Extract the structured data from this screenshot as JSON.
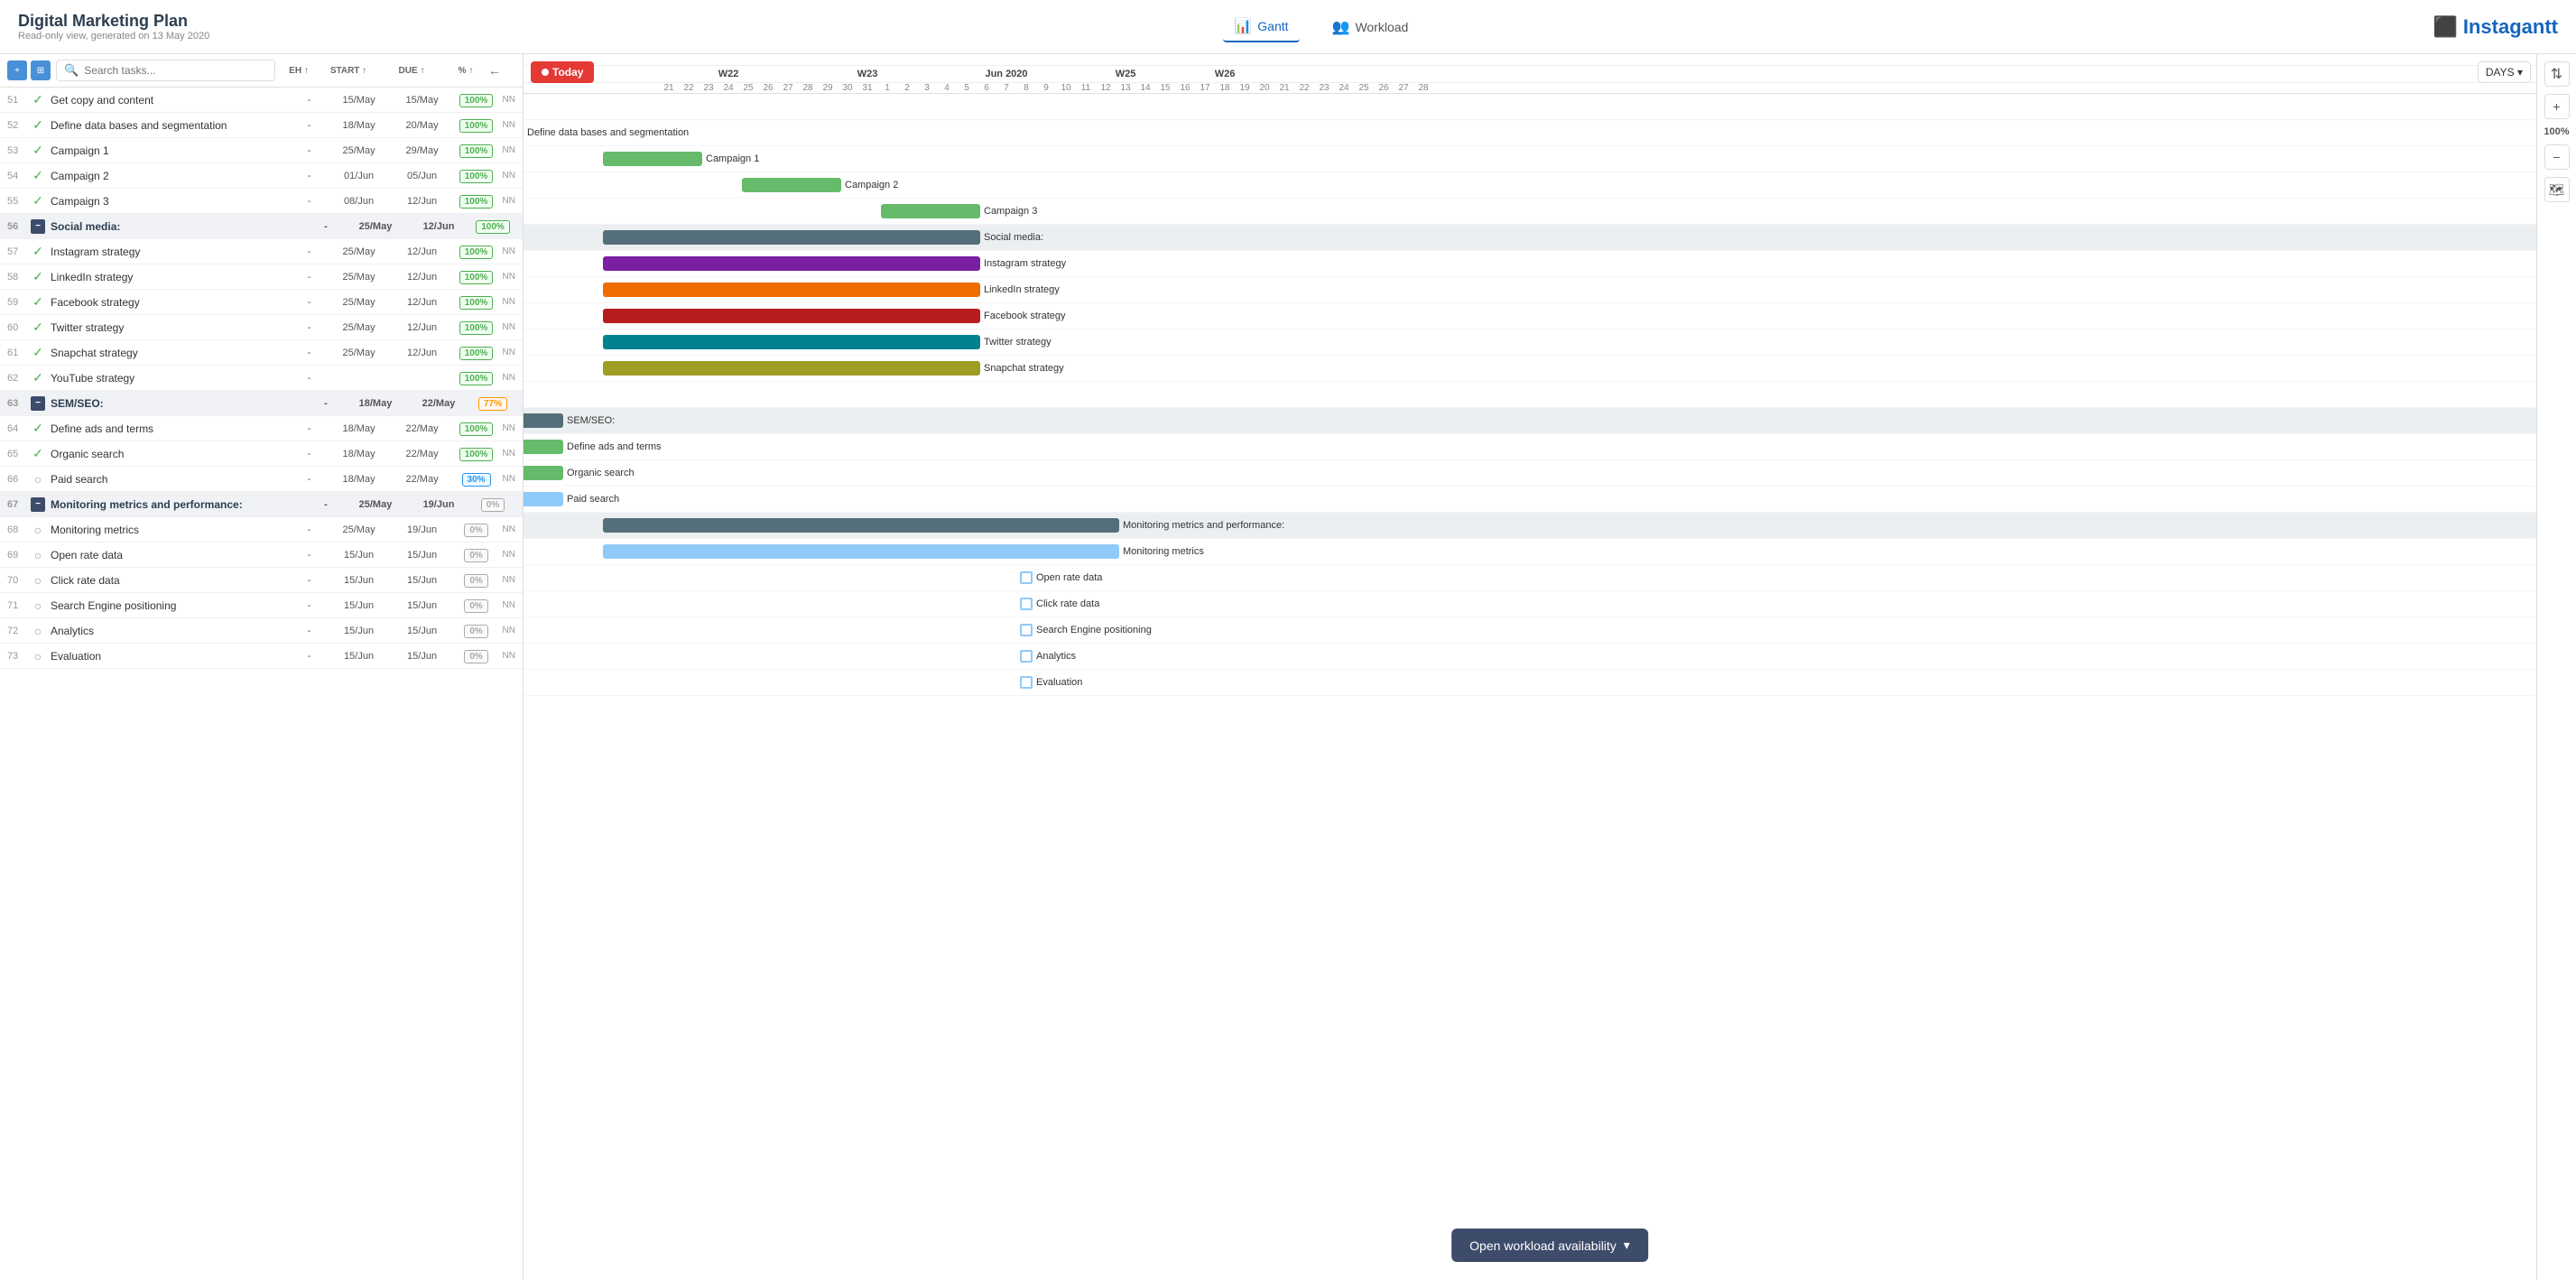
{
  "app": {
    "title": "Digital Marketing Plan",
    "subtitle": "Read-only view, generated on 13 May 2020",
    "logo": "Instagantt"
  },
  "nav": {
    "tabs": [
      {
        "id": "gantt",
        "label": "Gantt",
        "active": true
      },
      {
        "id": "workload",
        "label": "Workload",
        "active": false
      }
    ]
  },
  "toolbar": {
    "search_placeholder": "Search tasks...",
    "col_eh": "EH ↑",
    "col_start": "START ↑",
    "col_due": "DUE ↑",
    "col_pct": "% ↑"
  },
  "gantt": {
    "today_label": "Today",
    "days_label": "DAYS ▾",
    "open_workload_label": "Open workload availability",
    "weeks": [
      {
        "label": "W22",
        "span": 7
      },
      {
        "label": "W23",
        "span": 7
      },
      {
        "label": "Jun 2020",
        "span": 7
      },
      {
        "label": "W25",
        "span": 4
      },
      {
        "label": "W26",
        "span": 4
      }
    ],
    "days": [
      21,
      22,
      23,
      24,
      25,
      26,
      27,
      28,
      29,
      30,
      31,
      1,
      2,
      3,
      4,
      5,
      6,
      7,
      8,
      9,
      10,
      11,
      12,
      13,
      14,
      15,
      16,
      17,
      18,
      19,
      20,
      21,
      22,
      23,
      24,
      25,
      26,
      27,
      28
    ]
  },
  "tasks": [
    {
      "num": 51,
      "check": "done",
      "name": "Get copy and content",
      "eh": "-",
      "start": "15/May",
      "due": "15/May",
      "pct": "100%",
      "pct_class": "done",
      "assignee": "NN"
    },
    {
      "num": 52,
      "check": "done",
      "name": "Define data bases and segmentation",
      "eh": "-",
      "start": "18/May",
      "due": "20/May",
      "pct": "100%",
      "pct_class": "done",
      "assignee": "NN"
    },
    {
      "num": 53,
      "check": "done",
      "name": "Campaign 1",
      "eh": "-",
      "start": "25/May",
      "due": "29/May",
      "pct": "100%",
      "pct_class": "done",
      "assignee": "NN"
    },
    {
      "num": 54,
      "check": "done",
      "name": "Campaign 2",
      "eh": "-",
      "start": "01/Jun",
      "due": "05/Jun",
      "pct": "100%",
      "pct_class": "done",
      "assignee": "NN"
    },
    {
      "num": 55,
      "check": "done",
      "name": "Campaign 3",
      "eh": "-",
      "start": "08/Jun",
      "due": "12/Jun",
      "pct": "100%",
      "pct_class": "done",
      "assignee": "NN"
    },
    {
      "num": 56,
      "check": "group",
      "name": "Social media:",
      "eh": "-",
      "start": "25/May",
      "due": "12/Jun",
      "pct": "100%",
      "pct_class": "done",
      "assignee": "",
      "is_group": true
    },
    {
      "num": 57,
      "check": "done",
      "name": "Instagram strategy",
      "eh": "-",
      "start": "25/May",
      "due": "12/Jun",
      "pct": "100%",
      "pct_class": "done",
      "assignee": "NN"
    },
    {
      "num": 58,
      "check": "done",
      "name": "LinkedIn strategy",
      "eh": "-",
      "start": "25/May",
      "due": "12/Jun",
      "pct": "100%",
      "pct_class": "done",
      "assignee": "NN"
    },
    {
      "num": 59,
      "check": "done",
      "name": "Facebook strategy",
      "eh": "-",
      "start": "25/May",
      "due": "12/Jun",
      "pct": "100%",
      "pct_class": "done",
      "assignee": "NN"
    },
    {
      "num": 60,
      "check": "done",
      "name": "Twitter strategy",
      "eh": "-",
      "start": "25/May",
      "due": "12/Jun",
      "pct": "100%",
      "pct_class": "done",
      "assignee": "NN"
    },
    {
      "num": 61,
      "check": "done",
      "name": "Snapchat strategy",
      "eh": "-",
      "start": "25/May",
      "due": "12/Jun",
      "pct": "100%",
      "pct_class": "done",
      "assignee": "NN"
    },
    {
      "num": 62,
      "check": "done",
      "name": "YouTube strategy",
      "eh": "-",
      "start": "",
      "due": "",
      "pct": "100%",
      "pct_class": "done",
      "assignee": "NN"
    },
    {
      "num": 63,
      "check": "group",
      "name": "SEM/SEO:",
      "eh": "-",
      "start": "18/May",
      "due": "22/May",
      "pct": "77%",
      "pct_class": "amber",
      "assignee": "",
      "is_group": true
    },
    {
      "num": 64,
      "check": "done",
      "name": "Define ads and terms",
      "eh": "-",
      "start": "18/May",
      "due": "22/May",
      "pct": "100%",
      "pct_class": "done",
      "assignee": "NN"
    },
    {
      "num": 65,
      "check": "done",
      "name": "Organic search",
      "eh": "-",
      "start": "18/May",
      "due": "22/May",
      "pct": "100%",
      "pct_class": "done",
      "assignee": "NN"
    },
    {
      "num": 66,
      "check": "partial",
      "name": "Paid search",
      "eh": "-",
      "start": "18/May",
      "due": "22/May",
      "pct": "30%",
      "pct_class": "partial",
      "assignee": "NN"
    },
    {
      "num": 67,
      "check": "group",
      "name": "Monitoring metrics and performance:",
      "eh": "-",
      "start": "25/May",
      "due": "19/Jun",
      "pct": "0%",
      "pct_class": "zero",
      "assignee": "",
      "is_group": true
    },
    {
      "num": 68,
      "check": "partial",
      "name": "Monitoring metrics",
      "eh": "-",
      "start": "25/May",
      "due": "19/Jun",
      "pct": "0%",
      "pct_class": "zero",
      "assignee": "NN"
    },
    {
      "num": 69,
      "check": "partial",
      "name": "Open rate data",
      "eh": "-",
      "start": "15/Jun",
      "due": "15/Jun",
      "pct": "0%",
      "pct_class": "zero",
      "assignee": "NN"
    },
    {
      "num": 70,
      "check": "partial",
      "name": "Click rate data",
      "eh": "-",
      "start": "15/Jun",
      "due": "15/Jun",
      "pct": "0%",
      "pct_class": "zero",
      "assignee": "NN"
    },
    {
      "num": 71,
      "check": "partial",
      "name": "Search Engine positioning",
      "eh": "-",
      "start": "15/Jun",
      "due": "15/Jun",
      "pct": "0%",
      "pct_class": "zero",
      "assignee": "NN"
    },
    {
      "num": 72,
      "check": "partial",
      "name": "Analytics",
      "eh": "-",
      "start": "15/Jun",
      "due": "15/Jun",
      "pct": "0%",
      "pct_class": "zero",
      "assignee": "NN"
    },
    {
      "num": 73,
      "check": "partial",
      "name": "Evaluation",
      "eh": "-",
      "start": "15/Jun",
      "due": "15/Jun",
      "pct": "0%",
      "pct_class": "zero",
      "assignee": "NN"
    }
  ]
}
